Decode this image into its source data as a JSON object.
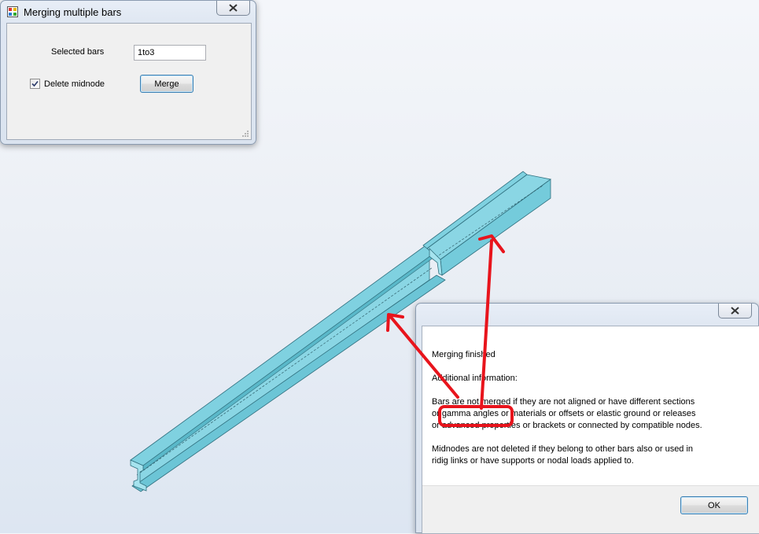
{
  "merge_dialog": {
    "title": "Merging multiple bars",
    "app_icon": "app-grid-icon",
    "close_icon": "close-icon",
    "selected_bars_label": "Selected bars",
    "selected_bars_value": "1to3",
    "delete_midnode_label": "Delete midnode",
    "delete_midnode_checked": true,
    "merge_button": "Merge"
  },
  "message_box": {
    "close_icon": "close-icon",
    "line_finished": "Merging finished",
    "line_additional": "Additional information:",
    "paragraph_bars": "Bars are not merged if they are not aligned or have different sections\nor gamma angles or materials or offsets or elastic ground or releases\nor advanced properties or brackets or connected by compatible nodes.",
    "paragraph_midnodes": "Midnodes are not deleted if they belong to other bars also or used in\nridig links or have supports or nodal loads applied to.",
    "ok_button": "OK"
  },
  "colors": {
    "beam_top": "#7fd1e0",
    "beam_side": "#6cc5d6",
    "beam_edge": "#2f6f7e",
    "annotation_red": "#e8141c"
  }
}
